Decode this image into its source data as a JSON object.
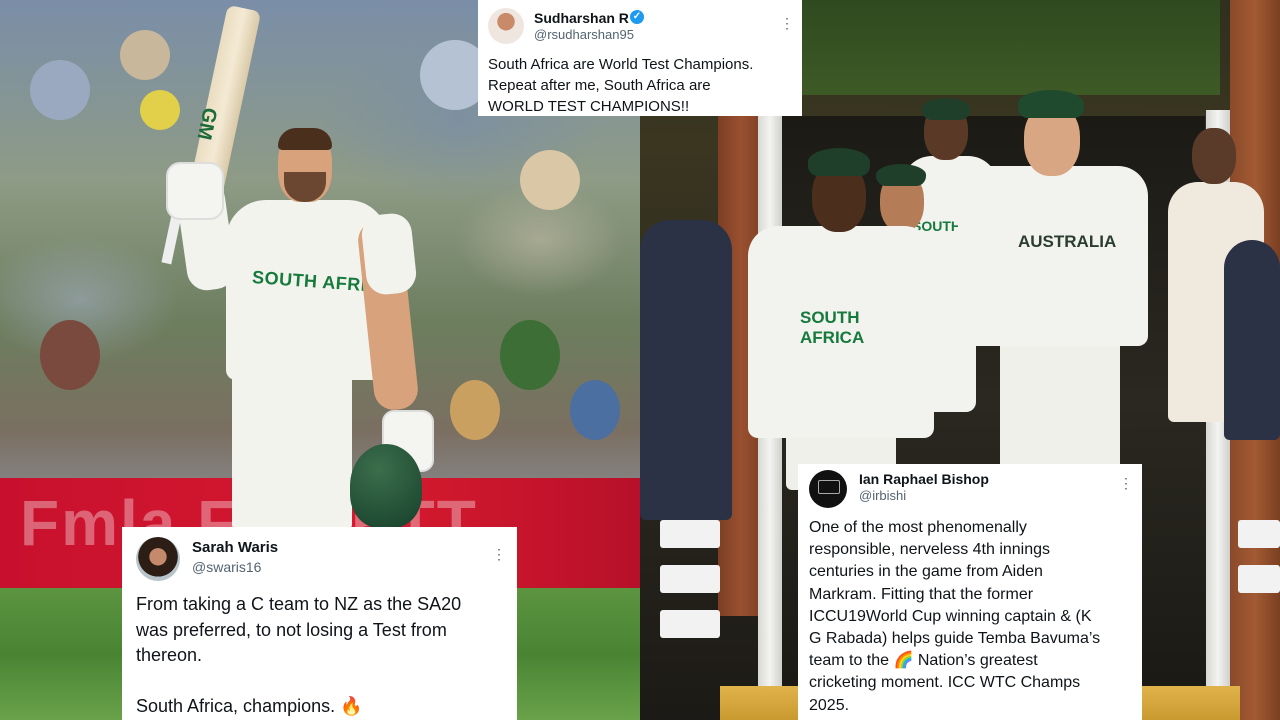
{
  "background": {
    "left_photo": {
      "jersey_text": "SOUTH AFRICA",
      "bat_logo": "GM"
    },
    "right_photo": {
      "jersey_left": "SOUTH AFRICA",
      "jersey_back": "SOUTH AFRICA",
      "jersey_right": "AUSTRALIA"
    }
  },
  "tweets": [
    {
      "id": "sudharshan",
      "name": "Sudharshan R",
      "handle": "@rsudharshan95",
      "verified": true,
      "more_icon": "⋮",
      "text": "South Africa are World Test Champions.\nRepeat after me, South Africa are\nWORLD TEST CHAMPIONS!!"
    },
    {
      "id": "sarah",
      "name": "Sarah Waris",
      "handle": "@swaris16",
      "verified": false,
      "more_icon": "⋮",
      "text": "From taking a C team to NZ as the SA20\nwas preferred, to not losing a Test from\nthereon.\n\nSouth Africa, champions. 🔥"
    },
    {
      "id": "ian",
      "name": "Ian Raphael Bishop",
      "handle": "@irbishi",
      "verified": false,
      "more_icon": "⋮",
      "text": "One of the most phenomenally\nresponsible, nerveless 4th innings\ncenturies in the game from Aiden\nMarkram. Fitting that the former\nICCU19World Cup winning captain & (K\nG Rabada) helps guide Temba Bavuma’s\nteam to the 🌈 Nation’s greatest\ncricketing moment. ICC WTC Champs\n2025."
    }
  ]
}
